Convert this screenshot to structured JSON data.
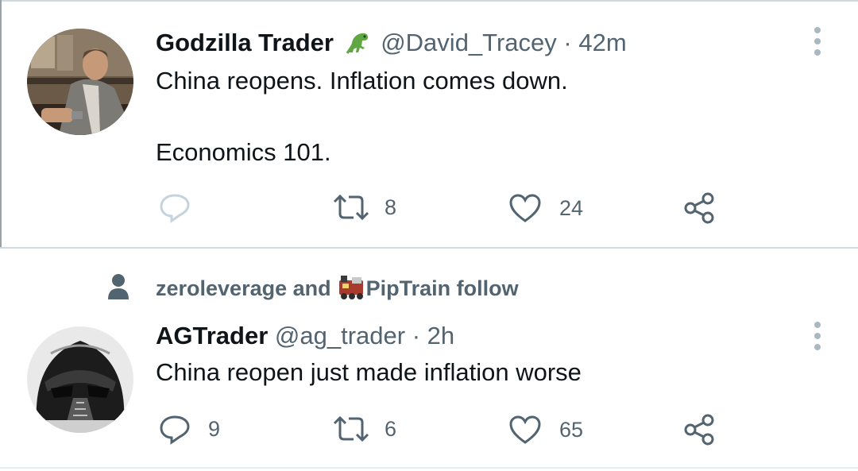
{
  "tweets": [
    {
      "name": "Godzilla Trader",
      "emoji_icon": "dinosaur-emoji",
      "handle": "@David_Tracey",
      "separator": "·",
      "time": "42m",
      "text_line1": "China reopens. Inflation comes down.",
      "text_line2": "Economics 101.",
      "replies": "",
      "retweets": "8",
      "likes": "24"
    },
    {
      "social_context": {
        "icon": "person-icon",
        "prefix": "zeroleverage and",
        "train_icon": "train-emoji",
        "suffix": "PipTrain follow"
      },
      "name": "AGTrader",
      "handle": "@ag_trader",
      "separator": "·",
      "time": "2h",
      "text": "China reopen just made inflation worse",
      "replies": "9",
      "retweets": "6",
      "likes": "65"
    }
  ],
  "colors": {
    "text_primary": "#0f1419",
    "text_secondary": "#536471",
    "icon_gray": "#536471",
    "divider": "#cfd9de",
    "reply_icon_faded": "#c5d3dc"
  }
}
